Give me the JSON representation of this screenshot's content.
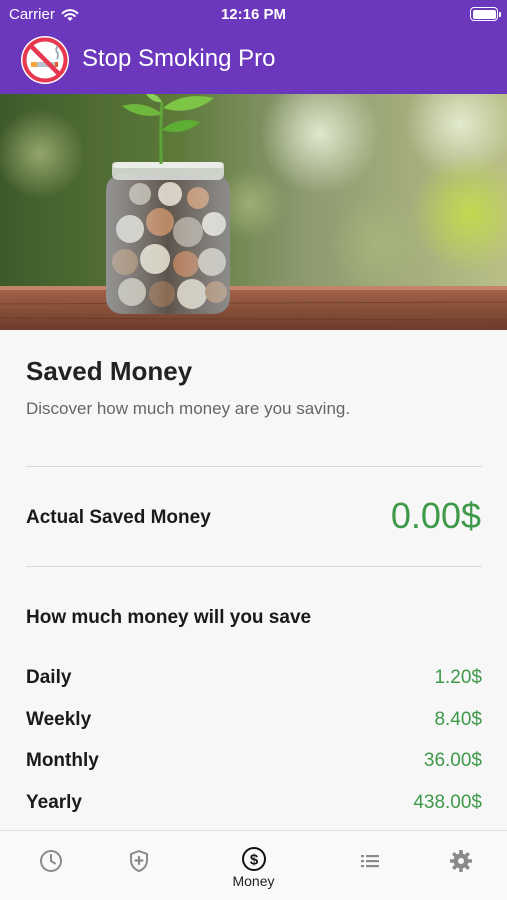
{
  "status_bar": {
    "carrier": "Carrier",
    "time": "12:16 PM"
  },
  "app_bar": {
    "title": "Stop Smoking Pro",
    "icon": "no-smoking-logo"
  },
  "hero": {
    "image": "coin-jar-with-plant"
  },
  "savings": {
    "title": "Saved Money",
    "subtitle": "Discover how much money are you saving.",
    "actual_label": "Actual Saved Money",
    "actual_value": "0.00$",
    "projection_title": "How much money will you save",
    "periods": [
      {
        "label": "Daily",
        "value": "1.20$"
      },
      {
        "label": "Weekly",
        "value": "8.40$"
      },
      {
        "label": "Monthly",
        "value": "36.00$"
      },
      {
        "label": "Yearly",
        "value": "438.00$"
      }
    ]
  },
  "tabs": [
    {
      "icon": "clock-icon",
      "label": ""
    },
    {
      "icon": "shield-plus-icon",
      "label": ""
    },
    {
      "icon": "dollar-circle-icon",
      "label": "Money",
      "active": true
    },
    {
      "icon": "list-icon",
      "label": ""
    },
    {
      "icon": "gear-icon",
      "label": ""
    }
  ],
  "colors": {
    "brand": "#6a37bd",
    "money_green": "#3e9a4a",
    "no_smoking_red": "#e8384f"
  }
}
